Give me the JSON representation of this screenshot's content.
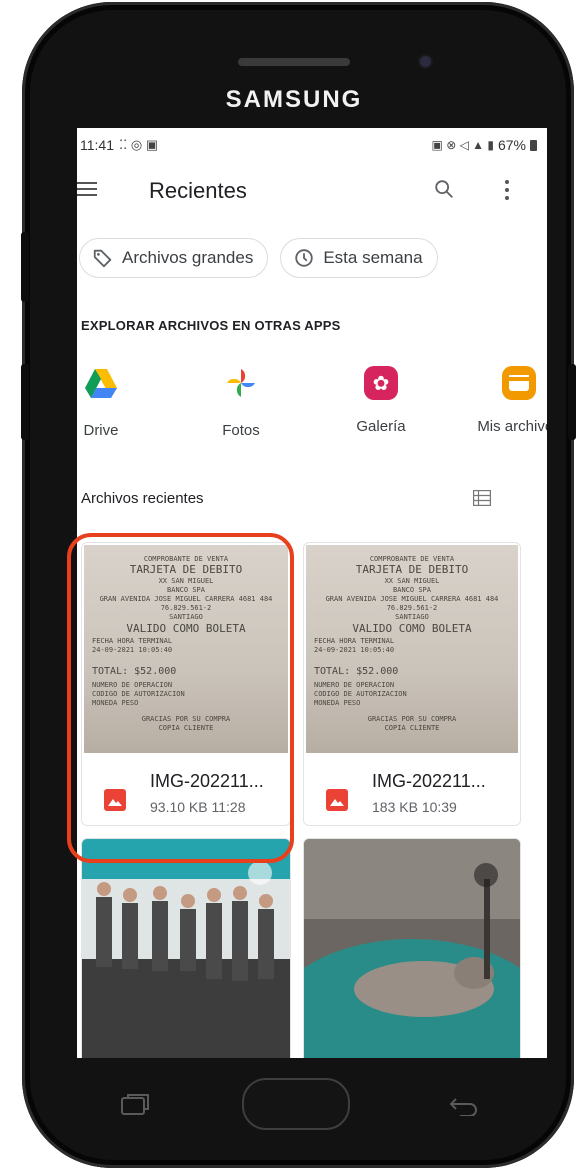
{
  "device": {
    "brand": "SAMSUNG"
  },
  "status_bar": {
    "time": "11:41",
    "battery": "67%"
  },
  "appbar": {
    "title": "Recientes"
  },
  "chips": [
    {
      "label": "Archivos grandes",
      "icon": "tag-icon"
    },
    {
      "label": "Esta semana",
      "icon": "history-icon"
    }
  ],
  "explore": {
    "title": "EXPLORAR ARCHIVOS EN OTRAS APPS",
    "apps": [
      {
        "label": "Drive",
        "icon": "drive-icon"
      },
      {
        "label": "Fotos",
        "icon": "photos-icon"
      },
      {
        "label": "Galería",
        "icon": "gallery-icon"
      },
      {
        "label": "Mis archivos",
        "icon": "my-files-icon"
      }
    ]
  },
  "recent": {
    "title": "Archivos recientes",
    "files": [
      {
        "name": "IMG-202211...",
        "meta": "93.10 KB 11:28"
      },
      {
        "name": "IMG-202211...",
        "meta": "183 KB 10:39"
      }
    ]
  },
  "receipt": {
    "lines": [
      "COMPROBANTE DE VENTA",
      "TARJETA DE DEBITO",
      "XX SAN MIGUEL",
      "BANCO SPA",
      "GRAN AVENIDA JOSE MIGUEL CARRERA 4681 484",
      "76.829.561-2",
      "SANTIAGO",
      "VALIDO COMO BOLETA",
      "FECHA HORA TERMINAL",
      "24-09-2021 10:05:40",
      "TOTAL: $52.000",
      "NUMERO DE OPERACION",
      "CODIGO DE AUTORIZACION",
      "MONEDA PESO",
      "GRACIAS POR SU COMPRA",
      "COPIA CLIENTE"
    ]
  },
  "colors": {
    "accent_red": "#e8401c",
    "image_icon": "#ea4335"
  }
}
